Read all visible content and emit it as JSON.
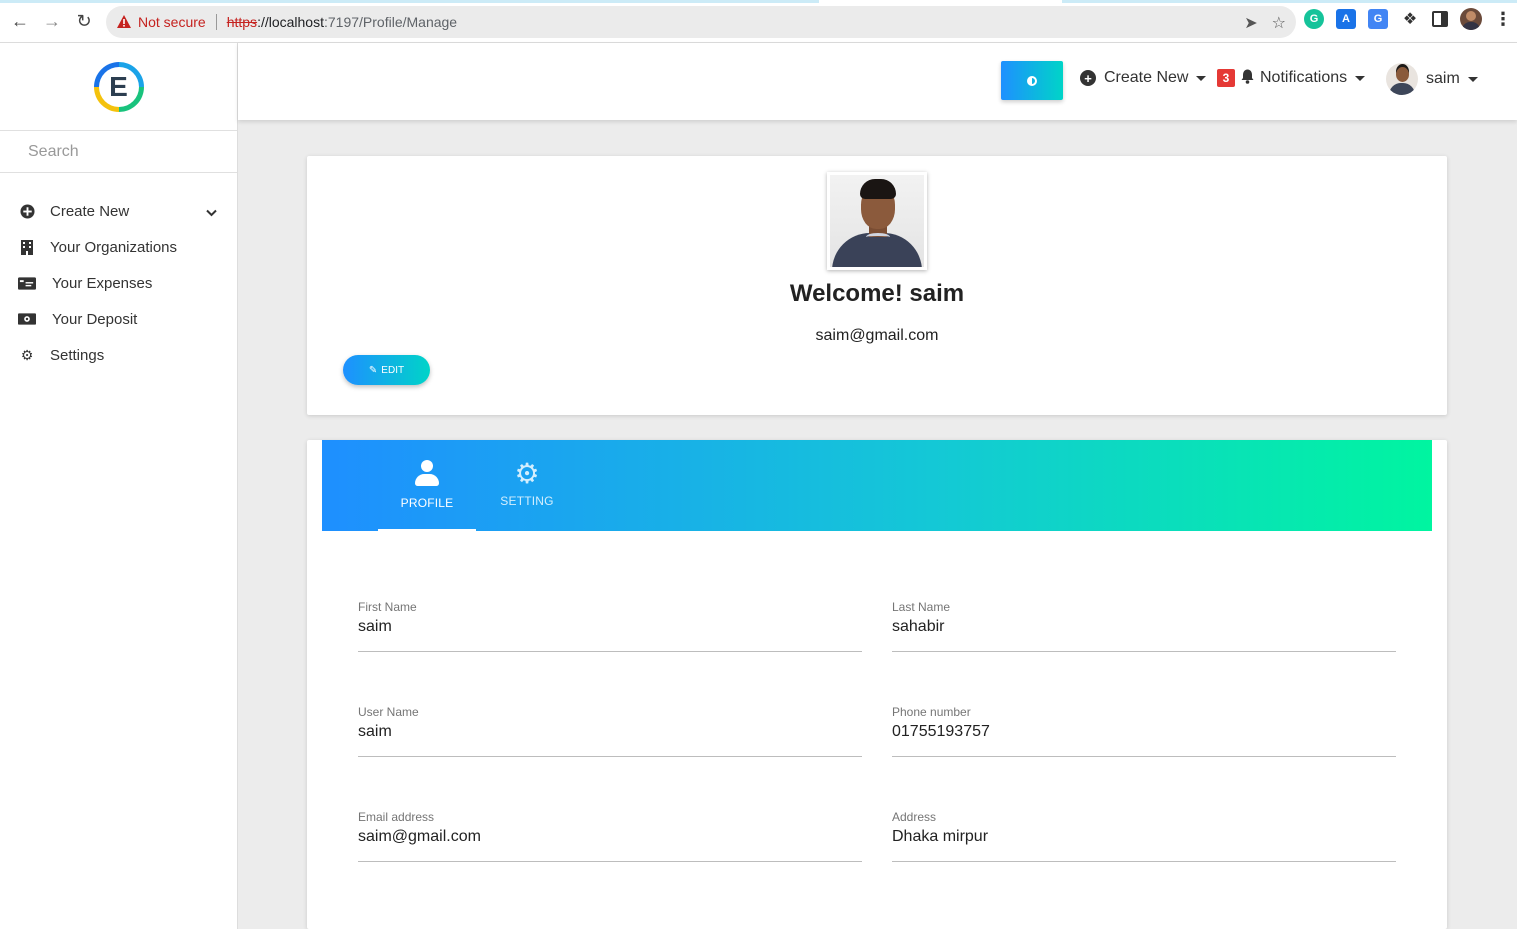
{
  "browser": {
    "security_label": "Not secure",
    "url_scheme": "https",
    "url_host": "://localhost",
    "url_path": ":7197/Profile/Manage"
  },
  "sidebar": {
    "logo_letter": "E",
    "search_placeholder": "Search",
    "items": [
      {
        "label": "Create New",
        "icon": "plus-circle-icon"
      },
      {
        "label": "Your Organizations",
        "icon": "building-icon"
      },
      {
        "label": "Your Expenses",
        "icon": "credit-card-icon"
      },
      {
        "label": "Your Deposit",
        "icon": "money-bill-icon"
      },
      {
        "label": "Settings",
        "icon": "gear-icon"
      }
    ]
  },
  "topbar": {
    "create_new": "Create New",
    "notification_count": "3",
    "notifications": "Notifications",
    "username": "saim"
  },
  "profile": {
    "welcome": "Welcome! saim",
    "email": "saim@gmail.com",
    "edit_label": "EDIT"
  },
  "tabs": [
    {
      "label": "PROFILE",
      "active": true
    },
    {
      "label": "SETTING",
      "active": false
    }
  ],
  "form": {
    "first_name": {
      "label": "First Name",
      "value": "saim"
    },
    "last_name": {
      "label": "Last Name",
      "value": "sahabir"
    },
    "user_name": {
      "label": "User Name",
      "value": "saim"
    },
    "phone": {
      "label": "Phone number",
      "value": "01755193757"
    },
    "email": {
      "label": "Email address",
      "value": "saim@gmail.com"
    },
    "address": {
      "label": "Address",
      "value": "Dhaka mirpur"
    }
  },
  "colors": {
    "gradient_start": "#1e8fff",
    "gradient_end": "#00f5a0",
    "badge": "#e53935",
    "not_secure": "#c5221f"
  }
}
